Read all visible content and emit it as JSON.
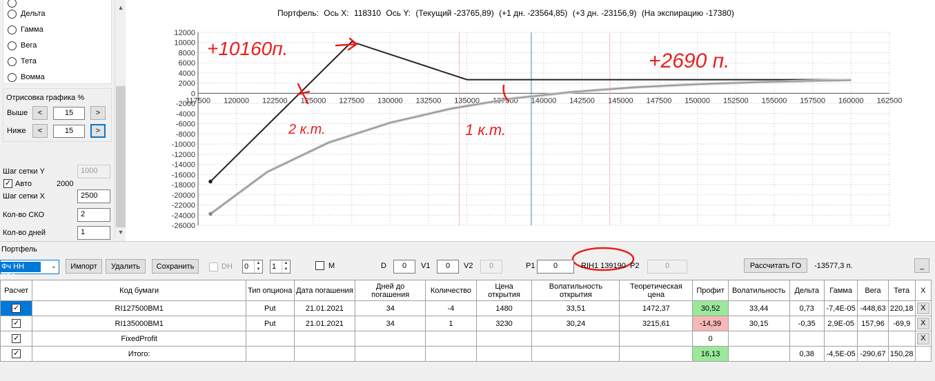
{
  "left": {
    "radios": [
      "Дельта",
      "Гамма",
      "Вега",
      "Тета",
      "Вомма"
    ],
    "draw_group_title": "Отрисовка графика %",
    "above_label": "Выше",
    "below_label": "Ниже",
    "above_value": "15",
    "below_value": "15",
    "dec_label": "<",
    "inc_label": ">",
    "grid_y_label": "Шаг сетки Y",
    "grid_y_value": "1000",
    "auto_label": "Авто",
    "auto_value": "2000",
    "grid_x_label": "Шаг сетки X",
    "grid_x_value": "2500",
    "sko_label": "Кол-во СКО",
    "sko_value": "2",
    "days_label": "Кол-во дней",
    "days_value": "1"
  },
  "chart": {
    "title_parts": [
      "Портфель:",
      "Ось X:",
      "118310",
      "Ось Y:",
      "(Текущий -23765,89)",
      "(+1 дн. -23564,85)",
      "(+3 дн. -23156,9)",
      "(На экспирацию -17380)"
    ]
  },
  "chart_data": {
    "type": "line",
    "x_ticks": [
      117500,
      120000,
      122500,
      125000,
      127500,
      130000,
      132500,
      135000,
      137500,
      140000,
      142500,
      145000,
      147500,
      150000,
      152500,
      155000,
      157500,
      160000,
      162500
    ],
    "y_ticks": [
      12000,
      10000,
      8000,
      6000,
      4000,
      2000,
      0,
      -2000,
      -4000,
      -6000,
      -8000,
      -10000,
      -12000,
      -14000,
      -16000,
      -18000,
      -20000,
      -22000,
      -24000,
      -26000
    ],
    "xlim": [
      117500,
      162500
    ],
    "ylim": [
      -26000,
      12000
    ],
    "grid": true,
    "current_price": 139190,
    "pink_lines": [
      134500,
      144300
    ],
    "series": [
      {
        "x": [
          118310,
          127500,
          135000,
          160000
        ],
        "y": [
          -17380,
          10160,
          2690,
          2690
        ],
        "color": "#222222"
      },
      {
        "x": [
          118310,
          122000,
          126000,
          130000,
          134000,
          138000,
          142000,
          146000,
          150000,
          154000,
          158000,
          160000
        ],
        "y": [
          -23766,
          -15500,
          -9700,
          -5800,
          -3000,
          -1000,
          300,
          1200,
          1800,
          2200,
          2500,
          2600
        ],
        "color": "#888888"
      }
    ],
    "annotations": [
      "+10160п.",
      "+2690 п.",
      "2 к.т.",
      "1 к.т."
    ]
  },
  "portfolio": {
    "label": "Портфель",
    "selected": "Фч НН РТС",
    "import_label": "Импорт",
    "delete_label": "Удалить",
    "save_label": "Сохранить",
    "dh_label": "DH",
    "spin1": "0",
    "spin2": "1",
    "m_label": "M",
    "d_label": "D",
    "d_value": "0",
    "v1_label": "V1",
    "v1_value": "0",
    "v2_label": "V2",
    "v2_value": "0",
    "p1_label": "P1",
    "p1_value": "0",
    "ticker_price": "RIH1 139190",
    "p2_label": "P2",
    "p2_value": "0",
    "calc_go_label": "Рассчитать ГО",
    "go_value": "-13577,3 п.",
    "minimize_label": "_"
  },
  "grid": {
    "headers": [
      "Расчет",
      "Код бумаги",
      "Тип опциона",
      "Дата погашения",
      "Дней до погашения",
      "Количество",
      "Цена открытия",
      "Волатильность открытия",
      "Теоретическая цена",
      "Профит",
      "Волатильность",
      "Дельта",
      "Гамма",
      "Вега",
      "Тета",
      "X"
    ],
    "rows": [
      [
        "✓",
        "RI127500BM1",
        "Put",
        "21.01.2021",
        "34",
        "-4",
        "1480",
        "33,51",
        "1472,37",
        "30,52",
        "33,44",
        "0,73",
        "-7,4E-05",
        "-448,63",
        "220,18",
        "X"
      ],
      [
        "✓",
        "RI135000BM1",
        "Put",
        "21.01.2021",
        "34",
        "1",
        "3230",
        "30,24",
        "3215,61",
        "-14,39",
        "30,15",
        "-0,35",
        "2,9E-05",
        "157,96",
        "-69,9",
        "X"
      ],
      [
        "✓",
        "FixedProfit",
        "",
        "",
        "",
        "",
        "",
        "",
        "",
        "0",
        "",
        "",
        "",
        "",
        "",
        "X"
      ],
      [
        "✓",
        "Итого:",
        "",
        "",
        "",
        "",
        "",
        "",
        "",
        "16,13",
        "",
        "0,38",
        "-4,5E-05",
        "-290,67",
        "150,28",
        ""
      ]
    ]
  },
  "colors": {
    "accent": "#0078d7",
    "profit_pos": "#9be89b",
    "profit_neg": "#f7b8b8",
    "annotation": "#e8201c"
  }
}
